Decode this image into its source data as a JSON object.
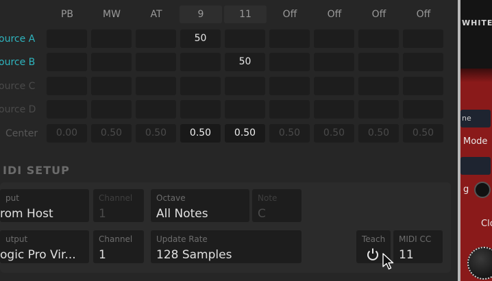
{
  "columns": [
    "PB",
    "MW",
    "AT",
    "9",
    "11",
    "Off",
    "Off",
    "Off",
    "Off"
  ],
  "rows": [
    {
      "label": "ource A",
      "values": [
        "",
        "",
        "",
        "50",
        "",
        "",
        "",
        "",
        ""
      ]
    },
    {
      "label": "ource B",
      "values": [
        "",
        "",
        "",
        "",
        "50",
        "",
        "",
        "",
        ""
      ]
    },
    {
      "label": "ource C",
      "values": [
        "",
        "",
        "",
        "",
        "",
        "",
        "",
        "",
        ""
      ]
    },
    {
      "label": "ource D",
      "values": [
        "",
        "",
        "",
        "",
        "",
        "",
        "",
        "",
        ""
      ]
    },
    {
      "label": "Center",
      "values": [
        "0.00",
        "0.50",
        "0.50",
        "0.50",
        "0.50",
        "0.50",
        "0.50",
        "0.50",
        "0.50"
      ]
    }
  ],
  "colors": {
    "accent": "#2fb5bf",
    "row_dim": "#4a4a4a",
    "center_label": "#585858",
    "panel": "#2b2b2b",
    "field": "#1d1d1d",
    "rack_red": "#8a1a1a"
  },
  "midi_setup": {
    "title": "IDI SETUP",
    "input": {
      "label": "put",
      "value": "rom Host"
    },
    "input_channel": {
      "label": "Channel",
      "value": "1"
    },
    "octave": {
      "label": "Octave",
      "value": "All Notes"
    },
    "note": {
      "label": "Note",
      "value": "C"
    },
    "output": {
      "label": "utput",
      "value": "ogic Pro Vir..."
    },
    "output_channel": {
      "label": "Channel",
      "value": "1"
    },
    "update_rate": {
      "label": "Update Rate",
      "value": "128 Samples"
    },
    "teach": {
      "label": "Teach",
      "icon": "power-icon"
    },
    "midi_cc": {
      "label": "MIDI CC",
      "value": "11"
    }
  },
  "right_panel": {
    "header": "WHITE",
    "field1": "ne",
    "mode_label": "Mode",
    "toggle_label": "g",
    "knob_label": "Clo"
  }
}
